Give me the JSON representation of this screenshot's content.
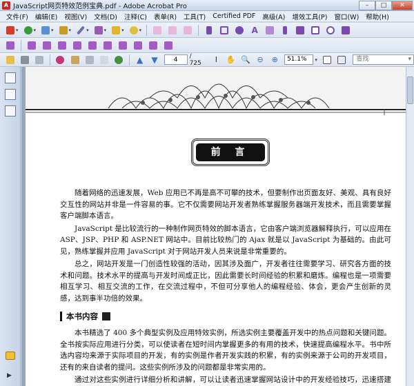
{
  "window": {
    "title": "JavaScript网页特效范例宝典.pdf - Adobe Acrobat Pro",
    "app_badge": "A",
    "minimize": "–",
    "maximize": "□",
    "close": "✕"
  },
  "menu": [
    "文件(F)",
    "编辑(E)",
    "视图(V)",
    "文档(D)",
    "注释(C)",
    "表单(R)",
    "工具(T)",
    "Certified PDF",
    "高级(A)",
    "增效工具(P)",
    "窗口(W)",
    "帮助(H)"
  ],
  "nav": {
    "current_page": "4",
    "page_count": "/ 725",
    "zoom": "51.1%",
    "find_placeholder": "查找",
    "find_dropdown": "▾"
  },
  "document": {
    "page_title": "前 言",
    "paragraphs_intro": [
      "随着网络的迅速发展，Web 应用已不再是高不可攀的技术，但要制作出页面友好、美观、具有良好交互性的网站并非是一件容易的事。它不仅需要网站开发者熟练掌握服务器端开发技术，而且需要掌握客户端脚本语言。",
      "JavaScript 是比较流行的一种制作网页特效的脚本语言，它由客户端浏览器解释执行，可以应用在 ASP、JSP、PHP 和 ASP.NET 网站中。目前比较热门的 Ajax 就是以 JavaScript 为基础的。由此可见，熟练掌握并应用 JavaScript 对于网站开发人员来说是非常重要的。",
      "总之，网站开发是一门创造性较强的活动，因其涉及面广，开发者往往需要学习、研究各方面的技术和问题。技术水平的提高与开发时间成正比，因此需要长时间经验的积累和磨炼。编程也是一项需要相互学习、相互交流的工作，在交流过程中，不但可分享他人的编程经验、体会，更会产生创新的灵感，达到事半功倍的效果。"
    ],
    "section_heading": "本书内容",
    "paragraphs_section": [
      "本书精选了 400 多个典型实例及应用特效实例，所选实例主要覆盖开发中的热点问题和关键问题。全书按实际应用进行分类，可以使读者在短时间内掌握更多的有用的技术，快速提高编程水平。书中所选内容均来源于实际项目的开发，有的实例是作者开发实践的积累，有的实例来源于公司的开发项目，还有的来自读者的提问。这些实例所涉及的问题都是非常实用的。",
      "通过对这些实例进行详细分析和讲解，可以让读者迅速掌握网站设计中的开发经验技巧，迅速搭建网站设计的综合能力。全书共 19 章，按照主题以专题方式分类编排，读者从书中的主"
    ]
  },
  "colors": {
    "titlebar": "#c8d6ea",
    "toolbar": "#dbe3ef",
    "doc_bg": "#9aa7b8",
    "page_bg": "#ffffff"
  }
}
